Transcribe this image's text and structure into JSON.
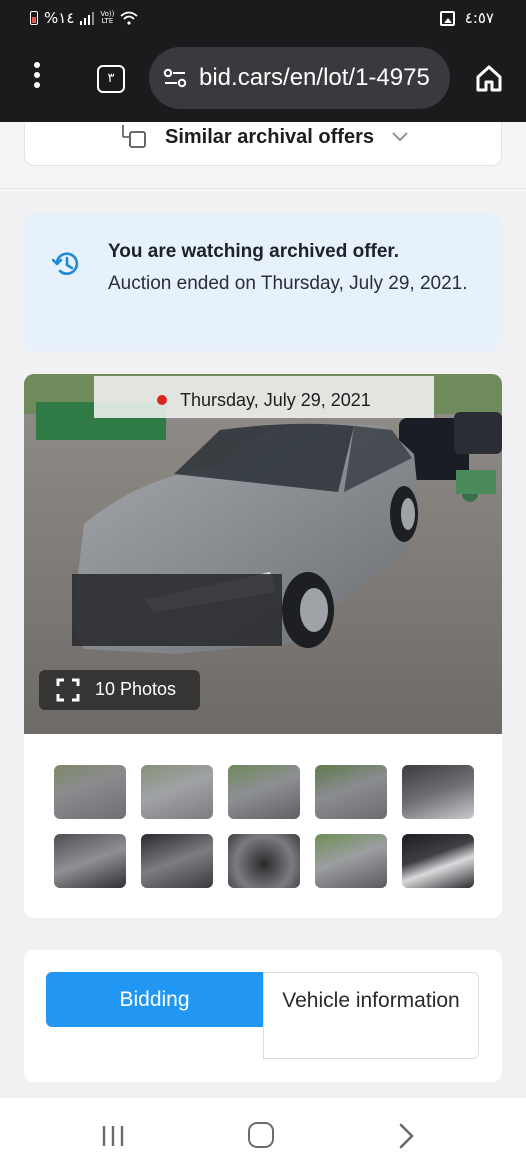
{
  "status_bar": {
    "battery": "%١٤",
    "network": "LTE",
    "volte": "Vo))",
    "time": "٤:٥٧"
  },
  "browser": {
    "tab_count": "٣",
    "url": "bid.cars/en/lot/1-4975"
  },
  "similar": {
    "label": "Similar archival offers"
  },
  "alert": {
    "title": "You are watching archived offer.",
    "body": "Auction ended on Thursday, July 29, 2021."
  },
  "gallery": {
    "date": "Thursday, July 29, 2021",
    "photos_label": "10 Photos",
    "thumbnails": [
      "car-front-left",
      "car-front-left-2",
      "car-front",
      "car-front-right",
      "interior-dashboard",
      "interior-rear-seats",
      "engine-bay",
      "instrument-cluster",
      "car-front-damage",
      "vin-label"
    ]
  },
  "tabs": {
    "bidding": "Bidding",
    "vehicle": "Vehicle information"
  },
  "colors": {
    "accent": "#2196f3",
    "alert_bg": "#e6f1fc",
    "alert_icon": "#1e8ad6",
    "status_dot": "#d9261c"
  }
}
